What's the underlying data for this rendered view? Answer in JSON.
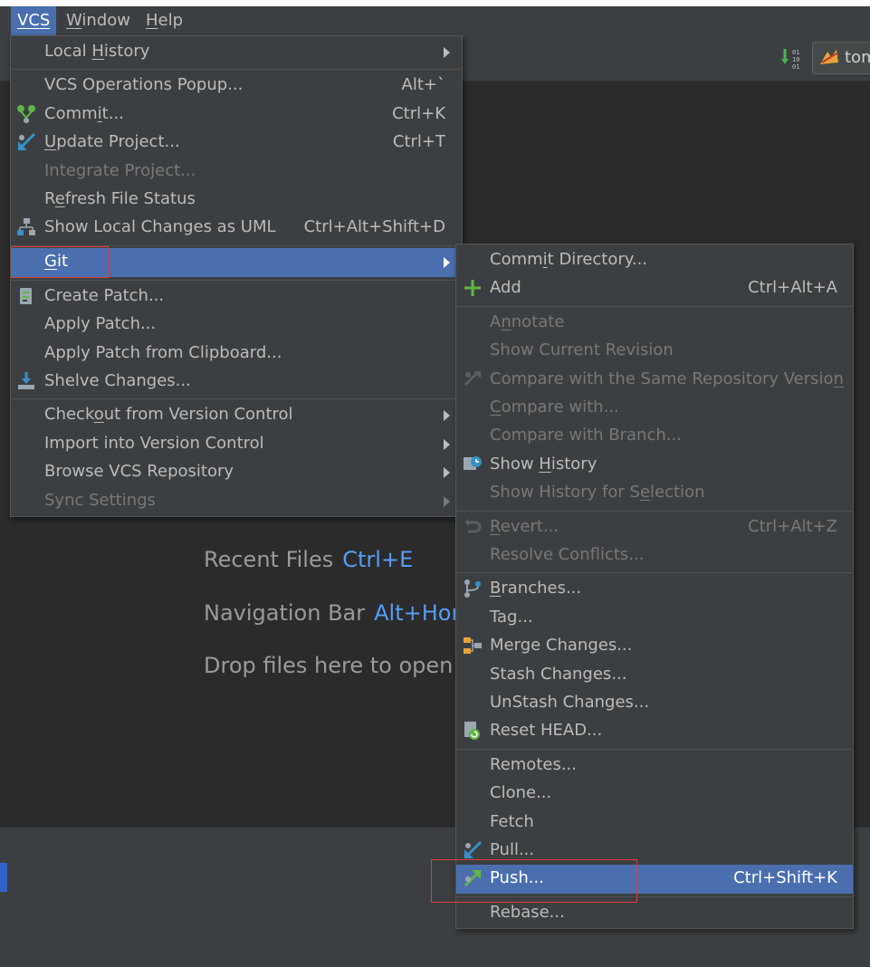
{
  "menubar": {
    "items": [
      {
        "label": "VCS",
        "mnemonic": 0
      },
      {
        "label": "Window",
        "mnemonic": 0
      },
      {
        "label": "Help",
        "mnemonic": 0
      }
    ]
  },
  "toolbar": {
    "run_config_label": "tom"
  },
  "editor_hints": [
    {
      "label": "Recent Files",
      "key": "Ctrl+E"
    },
    {
      "label": "Navigation Bar",
      "key": "Alt+Hon"
    },
    {
      "label": "Drop files here to open",
      "key": ""
    }
  ],
  "vcs_menu": {
    "items": [
      {
        "label": "Local History",
        "u": [
          6,
          7
        ],
        "shortcut": "",
        "submenu": true,
        "enabled": true,
        "icon": ""
      },
      {
        "label": "VCS Operations Popup...",
        "u": null,
        "shortcut": "Alt+`",
        "submenu": false,
        "enabled": true,
        "icon": ""
      },
      {
        "label": "Commit...",
        "u": [
          4,
          5
        ],
        "shortcut": "Ctrl+K",
        "submenu": false,
        "enabled": true,
        "icon": "commit-icon"
      },
      {
        "label": "Update Project...",
        "u": [
          0,
          1
        ],
        "shortcut": "Ctrl+T",
        "submenu": false,
        "enabled": true,
        "icon": "update-project-icon"
      },
      {
        "label": "Integrate Project...",
        "u": null,
        "shortcut": "",
        "submenu": false,
        "enabled": false,
        "icon": ""
      },
      {
        "label": "Refresh File Status",
        "u": [
          1,
          2
        ],
        "shortcut": "",
        "submenu": false,
        "enabled": true,
        "icon": ""
      },
      {
        "label": "Show Local Changes as UML",
        "u": null,
        "shortcut": "Ctrl+Alt+Shift+D",
        "submenu": false,
        "enabled": true,
        "icon": "uml-icon"
      },
      {
        "label": "Git",
        "u": [
          0,
          1
        ],
        "shortcut": "",
        "submenu": true,
        "enabled": true,
        "selected": true,
        "icon": ""
      },
      {
        "label": "Create Patch...",
        "u": null,
        "shortcut": "",
        "submenu": false,
        "enabled": true,
        "icon": "patch-icon"
      },
      {
        "label": "Apply Patch...",
        "u": null,
        "shortcut": "",
        "submenu": false,
        "enabled": true,
        "icon": ""
      },
      {
        "label": "Apply Patch from Clipboard...",
        "u": null,
        "shortcut": "",
        "submenu": false,
        "enabled": true,
        "icon": ""
      },
      {
        "label": "Shelve Changes...",
        "u": null,
        "shortcut": "",
        "submenu": false,
        "enabled": true,
        "icon": "shelve-icon"
      },
      {
        "label": "Checkout from Version Control",
        "u": [
          5,
          6
        ],
        "shortcut": "",
        "submenu": true,
        "enabled": true,
        "icon": ""
      },
      {
        "label": "Import into Version Control",
        "u": null,
        "shortcut": "",
        "submenu": true,
        "enabled": true,
        "icon": ""
      },
      {
        "label": "Browse VCS Repository",
        "u": null,
        "shortcut": "",
        "submenu": true,
        "enabled": true,
        "icon": ""
      },
      {
        "label": "Sync Settings",
        "u": null,
        "shortcut": "",
        "submenu": true,
        "enabled": false,
        "icon": ""
      }
    ]
  },
  "git_menu": {
    "items": [
      {
        "label": "Commit Directory...",
        "u": [
          4,
          5
        ],
        "shortcut": "",
        "enabled": true,
        "icon": ""
      },
      {
        "label": "Add",
        "u": null,
        "shortcut": "Ctrl+Alt+A",
        "enabled": true,
        "icon": "add-icon"
      },
      {
        "label": "Annotate",
        "u": [
          1,
          2
        ],
        "shortcut": "",
        "enabled": false,
        "icon": ""
      },
      {
        "label": "Show Current Revision",
        "u": null,
        "shortcut": "",
        "enabled": false,
        "icon": ""
      },
      {
        "label": "Compare with the Same Repository Version",
        "u": [
          39,
          40
        ],
        "shortcut": "",
        "enabled": false,
        "icon": "compare-icon"
      },
      {
        "label": "Compare with...",
        "u": [
          0,
          1
        ],
        "shortcut": "",
        "enabled": false,
        "icon": ""
      },
      {
        "label": "Compare with Branch...",
        "u": null,
        "shortcut": "",
        "enabled": false,
        "icon": ""
      },
      {
        "label": "Show History",
        "u": [
          5,
          6
        ],
        "shortcut": "",
        "enabled": true,
        "icon": "history-icon"
      },
      {
        "label": "Show History for Selection",
        "u": [
          18,
          19
        ],
        "shortcut": "",
        "enabled": false,
        "icon": ""
      },
      {
        "label": "Revert...",
        "u": [
          0,
          1
        ],
        "shortcut": "Ctrl+Alt+Z",
        "enabled": false,
        "icon": "revert-icon"
      },
      {
        "label": "Resolve Conflicts...",
        "u": null,
        "shortcut": "",
        "enabled": false,
        "icon": ""
      },
      {
        "label": "Branches...",
        "u": [
          0,
          1
        ],
        "shortcut": "",
        "enabled": true,
        "icon": "branches-icon"
      },
      {
        "label": "Tag...",
        "u": null,
        "shortcut": "",
        "enabled": true,
        "icon": ""
      },
      {
        "label": "Merge Changes...",
        "u": null,
        "shortcut": "",
        "enabled": true,
        "icon": "merge-icon"
      },
      {
        "label": "Stash Changes...",
        "u": null,
        "shortcut": "",
        "enabled": true,
        "icon": ""
      },
      {
        "label": "UnStash Changes...",
        "u": null,
        "shortcut": "",
        "enabled": true,
        "icon": ""
      },
      {
        "label": "Reset HEAD...",
        "u": null,
        "shortcut": "",
        "enabled": true,
        "icon": "reset-head-icon"
      },
      {
        "label": "Remotes...",
        "u": null,
        "shortcut": "",
        "enabled": true,
        "icon": ""
      },
      {
        "label": "Clone...",
        "u": null,
        "shortcut": "",
        "enabled": true,
        "icon": ""
      },
      {
        "label": "Fetch",
        "u": null,
        "shortcut": "",
        "enabled": true,
        "icon": ""
      },
      {
        "label": "Pull...",
        "u": null,
        "shortcut": "",
        "enabled": true,
        "icon": "pull-icon"
      },
      {
        "label": "Push...",
        "u": null,
        "shortcut": "Ctrl+Shift+K",
        "enabled": true,
        "selected": true,
        "icon": "push-icon"
      },
      {
        "label": "Rebase...",
        "u": null,
        "shortcut": "",
        "enabled": true,
        "icon": ""
      }
    ]
  },
  "colors": {
    "menu_bg": "#3c3f41",
    "selection": "#4b6eaf",
    "text": "#bbbbbb",
    "disabled": "#777777",
    "editor_bg": "#2b2b2b",
    "hint_key": "#589df6",
    "highlight_box": "#e03b3b"
  }
}
